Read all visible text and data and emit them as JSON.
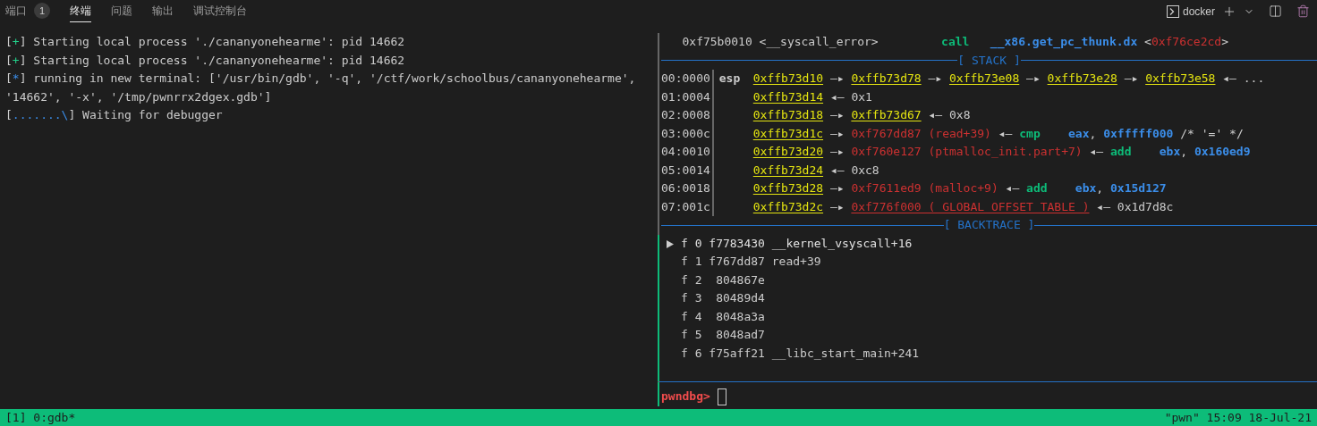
{
  "tabs": [
    {
      "label": "端口",
      "selected": false,
      "badge": "1"
    },
    {
      "label": "终端",
      "selected": true
    },
    {
      "label": "问题",
      "selected": false
    },
    {
      "label": "输出",
      "selected": false
    },
    {
      "label": "调试控制台",
      "selected": false
    }
  ],
  "toolbar": {
    "profile": "docker"
  },
  "left_lines": [
    [
      {
        "text": "[",
        "kind": "plain"
      },
      {
        "text": "+",
        "kind": "ok"
      },
      {
        "text": "] Starting local process './cananyonehearme': pid 14662",
        "kind": "plain"
      }
    ],
    [
      {
        "text": "[",
        "kind": "plain"
      },
      {
        "text": "+",
        "kind": "ok"
      },
      {
        "text": "] Starting local process './cananyonehearme': pid 14662",
        "kind": "plain"
      }
    ],
    [
      {
        "text": "[",
        "kind": "plain"
      },
      {
        "text": "*",
        "kind": "info"
      },
      {
        "text": "] running in new terminal: ['/usr/bin/gdb', '-q', '/ctf/work/schoolbus/cananyonehearme',",
        "kind": "plain"
      }
    ],
    [
      {
        "text": "'14662', '-x', '/tmp/pwnrrx2dgex.gdb']",
        "kind": "plain"
      }
    ],
    [
      {
        "text": "[",
        "kind": "plain"
      },
      {
        "text": ".......\\",
        "kind": "info"
      },
      {
        "text": "] Waiting for debugger",
        "kind": "plain"
      }
    ]
  ],
  "disasm": [
    {
      "text": "   0xf75b0010 <__syscall_error>         ",
      "kind": "plain"
    },
    {
      "text": "call",
      "kind": "op"
    },
    {
      "text": "__x86.get_pc_thunk.dx",
      "kind": "reg"
    },
    {
      "text": " <",
      "kind": "plain"
    },
    {
      "text": "0xf76ce2cd",
      "kind": "code"
    },
    {
      "text": ">",
      "kind": "plain"
    }
  ],
  "stack_header": "[ STACK ]",
  "stack": [
    {
      "index": "00:0000",
      "reg": "esp",
      "segs": [
        {
          "text": "0xffb73d10",
          "kind": "addr"
        },
        {
          "text": " —▸ ",
          "kind": "plain"
        },
        {
          "text": "0xffb73d78",
          "kind": "addr"
        },
        {
          "text": " —▸ ",
          "kind": "plain"
        },
        {
          "text": "0xffb73e08",
          "kind": "addr"
        },
        {
          "text": " —▸ ",
          "kind": "plain"
        },
        {
          "text": "0xffb73e28",
          "kind": "addr"
        },
        {
          "text": " —▸ ",
          "kind": "plain"
        },
        {
          "text": "0xffb73e58",
          "kind": "addr"
        },
        {
          "text": " ◂— ...",
          "kind": "plain"
        }
      ]
    },
    {
      "index": "01:0004",
      "segs": [
        {
          "text": "0xffb73d14",
          "kind": "addr"
        },
        {
          "text": " ◂— 0x1",
          "kind": "plain"
        }
      ]
    },
    {
      "index": "02:0008",
      "segs": [
        {
          "text": "0xffb73d18",
          "kind": "addr"
        },
        {
          "text": " —▸ ",
          "kind": "plain"
        },
        {
          "text": "0xffb73d67",
          "kind": "addr"
        },
        {
          "text": " ◂— 0x8",
          "kind": "plain"
        }
      ]
    },
    {
      "index": "03:000c",
      "segs": [
        {
          "text": "0xffb73d1c",
          "kind": "addr"
        },
        {
          "text": " —▸ ",
          "kind": "plain"
        },
        {
          "text": "0xf767dd87 (read+39)",
          "kind": "code"
        },
        {
          "text": " ◂— ",
          "kind": "plain"
        },
        {
          "text": "cmp",
          "kind": "op"
        },
        {
          "text": "eax",
          "kind": "reg"
        },
        {
          "text": ", ",
          "kind": "plain"
        },
        {
          "text": "0xfffff000",
          "kind": "reg"
        },
        {
          "text": " /* '=' */",
          "kind": "plain"
        }
      ]
    },
    {
      "index": "04:0010",
      "segs": [
        {
          "text": "0xffb73d20",
          "kind": "addr"
        },
        {
          "text": " —▸ ",
          "kind": "plain"
        },
        {
          "text": "0xf760e127 (ptmalloc_init.part+7)",
          "kind": "code"
        },
        {
          "text": " ◂— ",
          "kind": "plain"
        },
        {
          "text": "add",
          "kind": "op"
        },
        {
          "text": "ebx",
          "kind": "reg"
        },
        {
          "text": ", ",
          "kind": "plain"
        },
        {
          "text": "0x160ed9",
          "kind": "reg"
        }
      ]
    },
    {
      "index": "05:0014",
      "segs": [
        {
          "text": "0xffb73d24",
          "kind": "addr"
        },
        {
          "text": " ◂— 0xc8",
          "kind": "plain"
        }
      ]
    },
    {
      "index": "06:0018",
      "segs": [
        {
          "text": "0xffb73d28",
          "kind": "addr"
        },
        {
          "text": " —▸ ",
          "kind": "plain"
        },
        {
          "text": "0xf7611ed9 (malloc+9)",
          "kind": "code"
        },
        {
          "text": " ◂— ",
          "kind": "plain"
        },
        {
          "text": "add",
          "kind": "op"
        },
        {
          "text": "ebx",
          "kind": "reg"
        },
        {
          "text": ", ",
          "kind": "plain"
        },
        {
          "text": "0x15d127",
          "kind": "reg"
        }
      ]
    },
    {
      "index": "07:001c",
      "segs": [
        {
          "text": "0xffb73d2c",
          "kind": "addr"
        },
        {
          "text": " —▸ ",
          "kind": "plain"
        },
        {
          "text": "0xf776f000 (_GLOBAL_OFFSET_TABLE_)",
          "kind": "code_ul"
        },
        {
          "text": " ◂— 0x1d7d8c",
          "kind": "plain"
        }
      ]
    }
  ],
  "backtrace_header": "[ BACKTRACE ]",
  "frames": [
    {
      "text": "f 0 f7783430 __kernel_vsyscall+16",
      "selected": true
    },
    {
      "text": "f 1 f767dd87 read+39",
      "selected": false
    },
    {
      "text": "f 2  804867e",
      "selected": false
    },
    {
      "text": "f 3  80489d4",
      "selected": false
    },
    {
      "text": "f 4  8048a3a",
      "selected": false
    },
    {
      "text": "f 5  8048ad7",
      "selected": false
    },
    {
      "text": "f 6 f75aff21 __libc_start_main+241",
      "selected": false
    }
  ],
  "prompt": "pwndbg>",
  "status_bar": {
    "left": "[1] 0:gdb*",
    "right": "\"pwn\" 15:09 18-Jul-21"
  }
}
